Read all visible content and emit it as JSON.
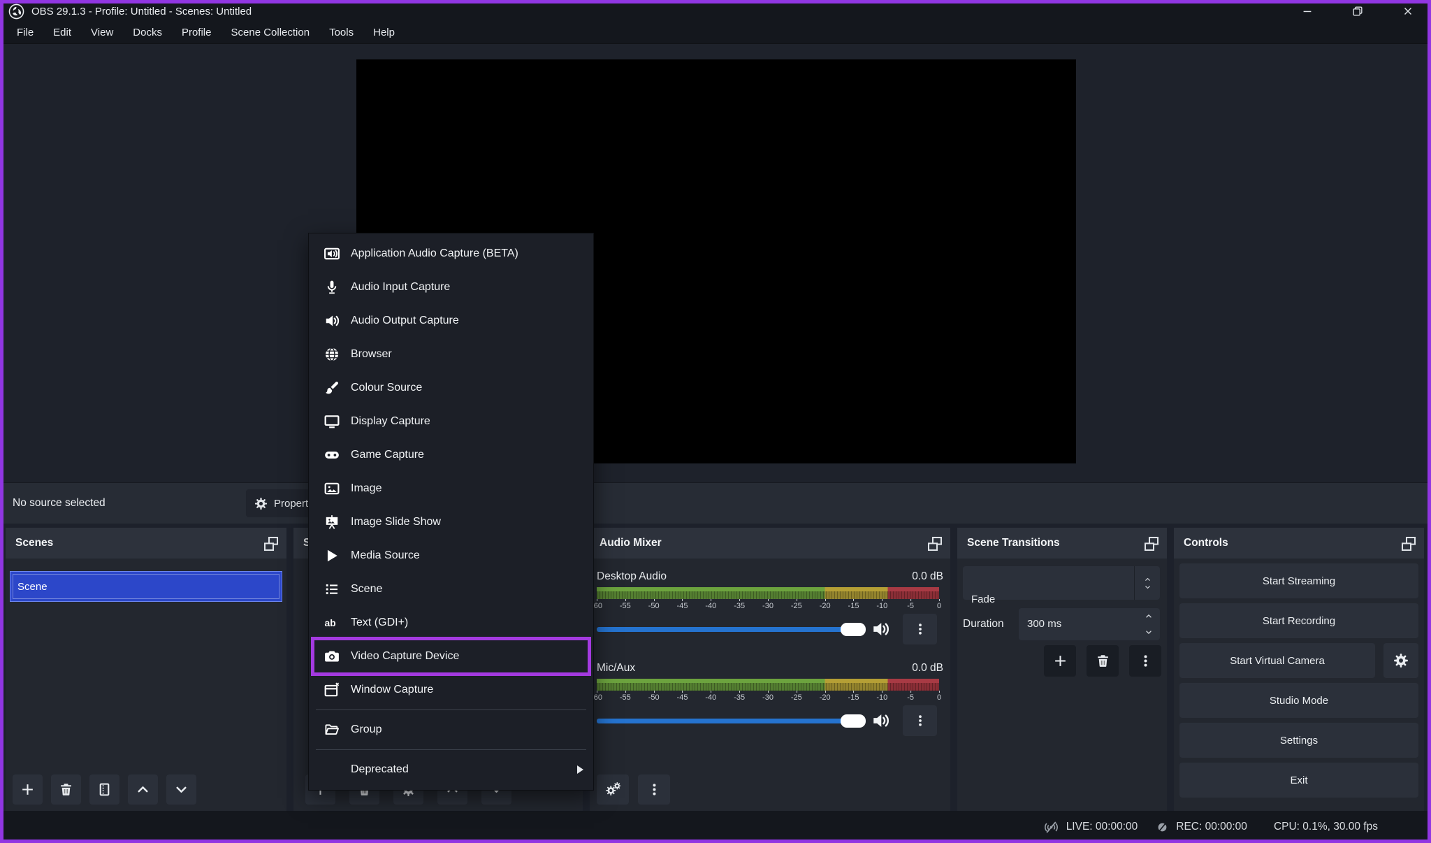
{
  "window": {
    "title": "OBS 29.1.3 - Profile: Untitled - Scenes: Untitled",
    "controls": [
      "min",
      "restore",
      "close"
    ]
  },
  "menu_bar": [
    "File",
    "Edit",
    "View",
    "Docks",
    "Profile",
    "Scene Collection",
    "Tools",
    "Help"
  ],
  "context_bar": {
    "status": "No source selected",
    "properties_label": "Properties"
  },
  "source_menu": {
    "items": [
      {
        "icon": "app-audio",
        "label": "Application Audio Capture (BETA)"
      },
      {
        "icon": "mic",
        "label": "Audio Input Capture"
      },
      {
        "icon": "speaker",
        "label": "Audio Output Capture"
      },
      {
        "icon": "globe",
        "label": "Browser"
      },
      {
        "icon": "brush",
        "label": "Colour Source"
      },
      {
        "icon": "display",
        "label": "Display Capture"
      },
      {
        "icon": "gamepad",
        "label": "Game Capture"
      },
      {
        "icon": "image",
        "label": "Image"
      },
      {
        "icon": "slideshow",
        "label": "Image Slide Show"
      },
      {
        "icon": "play",
        "label": "Media Source"
      },
      {
        "icon": "list",
        "label": "Scene"
      },
      {
        "icon": "text",
        "label": "Text (GDI+)"
      },
      {
        "icon": "camera",
        "label": "Video Capture Device",
        "highlighted": true
      },
      {
        "icon": "window",
        "label": "Window Capture"
      },
      {
        "type": "separator"
      },
      {
        "icon": "folder",
        "label": "Group"
      },
      {
        "type": "separator"
      },
      {
        "label": "Deprecated",
        "submenu": true
      }
    ]
  },
  "docks": {
    "scenes": {
      "title": "Scenes",
      "items": [
        {
          "label": "Scene",
          "selected": true
        }
      ],
      "toolbar": [
        "plus",
        "trash",
        "filters",
        "chevron-up",
        "chevron-down"
      ]
    },
    "sources": {
      "title": "Sources",
      "toolbar": [
        "plus",
        "trash",
        "gear",
        "chevron-up",
        "chevron-down"
      ]
    },
    "audio_mixer": {
      "title": "Audio Mixer",
      "channels": [
        {
          "name": "Desktop Audio",
          "level": "0.0 dB"
        },
        {
          "name": "Mic/Aux",
          "level": "0.0 dB"
        }
      ],
      "scale": [
        "-60",
        "-55",
        "-50",
        "-45",
        "-40",
        "-35",
        "-30",
        "-25",
        "-20",
        "-15",
        "-10",
        "-5",
        "0"
      ],
      "toolbar": [
        "gear-double",
        "dots"
      ]
    },
    "scene_transitions": {
      "title": "Scene Transitions",
      "transition": "Fade",
      "duration_label": "Duration",
      "duration_value": "300 ms",
      "toolbar": [
        "plus",
        "trash",
        "dots"
      ]
    },
    "controls": {
      "title": "Controls",
      "buttons": [
        {
          "label": "Start Streaming"
        },
        {
          "label": "Start Recording"
        },
        {
          "label": "Start Virtual Camera",
          "gear": true
        },
        {
          "label": "Studio Mode"
        },
        {
          "label": "Settings"
        },
        {
          "label": "Exit"
        }
      ]
    }
  },
  "status_bar": {
    "live": "LIVE: 00:00:00",
    "rec": "REC: 00:00:00",
    "cpu": "CPU: 0.1%, 30.00 fps"
  },
  "colors": {
    "accent_blue": "#2c47c9",
    "slider_blue": "#2573cf",
    "highlight_purple": "#a43ae0",
    "frame_purple": "#9136e2"
  }
}
